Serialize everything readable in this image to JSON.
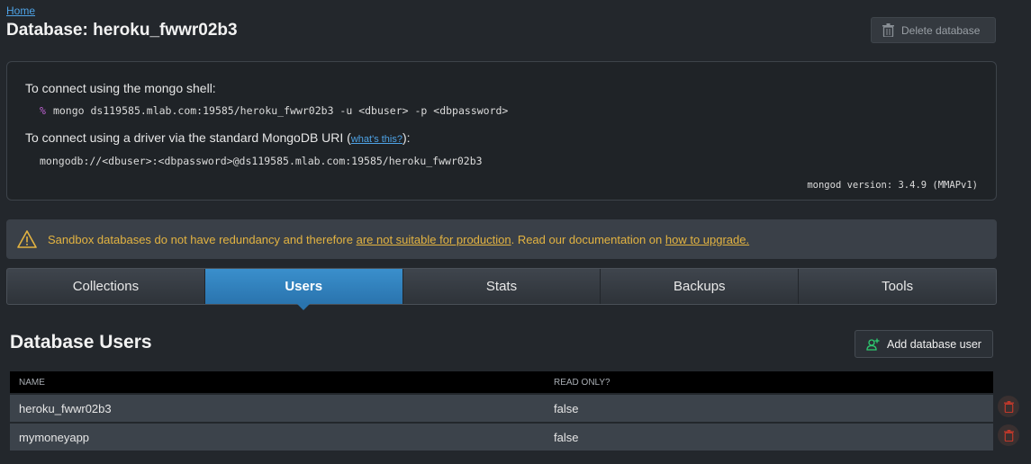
{
  "breadcrumb": {
    "home": "Home"
  },
  "page": {
    "title": "Database: heroku_fwwr02b3"
  },
  "actions": {
    "delete_database": "Delete database"
  },
  "connect": {
    "shell_label": "To connect using the mongo shell:",
    "shell_prompt": "%",
    "shell_command": "mongo ds119585.mlab.com:19585/heroku_fwwr02b3 -u <dbuser> -p <dbpassword>",
    "driver_label_pre": "To connect using a driver via the standard MongoDB URI (",
    "driver_link": "what's this?",
    "driver_label_post": "):",
    "uri": "mongodb://<dbuser>:<dbpassword>@ds119585.mlab.com:19585/heroku_fwwr02b3",
    "version": "mongod version: 3.4.9 (MMAPv1)"
  },
  "warning": {
    "text_pre": "Sandbox databases do not have redundancy and therefore ",
    "link1": "are not suitable for production",
    "text_mid": ". Read our documentation on ",
    "link2": "how to upgrade."
  },
  "tabs": [
    {
      "label": "Collections"
    },
    {
      "label": "Users",
      "active": true
    },
    {
      "label": "Stats"
    },
    {
      "label": "Backups"
    },
    {
      "label": "Tools"
    }
  ],
  "users_section": {
    "title": "Database Users",
    "add_button": "Add database user",
    "columns": [
      "NAME",
      "READ ONLY?"
    ],
    "rows": [
      {
        "name": "heroku_fwwr02b3",
        "read_only": "false"
      },
      {
        "name": "mymoneyapp",
        "read_only": "false"
      }
    ]
  },
  "colors": {
    "accent": "#2a74ae",
    "warning": "#e3b341",
    "danger": "#c0392b",
    "add_icon": "#2ecc71"
  }
}
